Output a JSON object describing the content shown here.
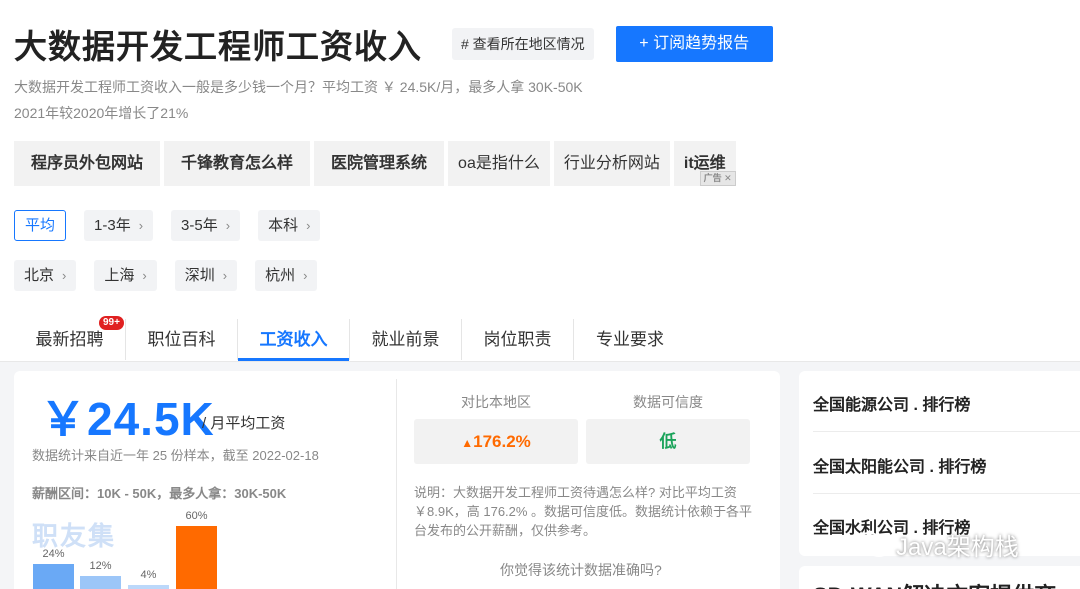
{
  "header": {
    "title": "大数据开发工程师工资收入",
    "region_tag": "# 查看所在地区情况",
    "subscribe_button": "+ 订阅趋势报告",
    "description": "大数据开发工程师工资收入一般是多少钱一个月？平均工资 ￥ 24.5K/月，最多人拿 30K-50K",
    "growth_note": "2021年较2020年增长了21%"
  },
  "keywords": [
    "程序员外包网站",
    "千锋教育怎么样",
    "医院管理系统",
    "oa是指什么",
    "行业分析网站",
    "it运维"
  ],
  "ad_mark": "广告 ✕",
  "filters": {
    "experience": [
      {
        "label": "平均",
        "active": true
      },
      {
        "label": "1-3年",
        "active": false
      },
      {
        "label": "3-5年",
        "active": false
      },
      {
        "label": "本科",
        "active": false
      }
    ],
    "cities": [
      "北京",
      "上海",
      "深圳",
      "杭州"
    ]
  },
  "tabs": [
    {
      "label": "最新招聘",
      "badge": "99+"
    },
    {
      "label": "职位百科"
    },
    {
      "label": "工资收入",
      "active": true
    },
    {
      "label": "就业前景"
    },
    {
      "label": "岗位职责"
    },
    {
      "label": "专业要求"
    }
  ],
  "salary": {
    "value": "￥24.5K",
    "unit": "/ 月平均工资",
    "stat_note": "数据统计来自近一年 25 份样本，截至 2022-02-18",
    "range_note": "薪酬区间：10K - 50K，最多人拿：30K-50K",
    "watermark": "职友集"
  },
  "chart_data": {
    "type": "bar",
    "values": [
      24,
      12,
      4,
      60
    ],
    "labels": [
      "24%",
      "12%",
      "4%",
      "60%"
    ],
    "colors": [
      "#6aa9f5",
      "#9cc6f8",
      "#bcd8fa",
      "#ff6a00"
    ]
  },
  "comparison": {
    "local_label": "对比本地区",
    "local_value": "176.2%",
    "reliability_label": "数据可信度",
    "reliability_value": "低",
    "explanation": "说明：大数据开发工程师工资待遇怎么样? 对比平均工资 ￥8.9K，高 176.2% 。数据可信度低。数据统计依赖于各平台发布的公开薪酬，仅供参考。",
    "accuracy_question": "你觉得该统计数据准确吗?"
  },
  "rankings": [
    "全国能源公司 . 排行榜",
    "全国太阳能公司 . 排行榜",
    "全国水利公司 . 排行榜"
  ],
  "next_section_title": "SD-WAN解决方案提供商",
  "wechat_watermark": "Java架构栈"
}
